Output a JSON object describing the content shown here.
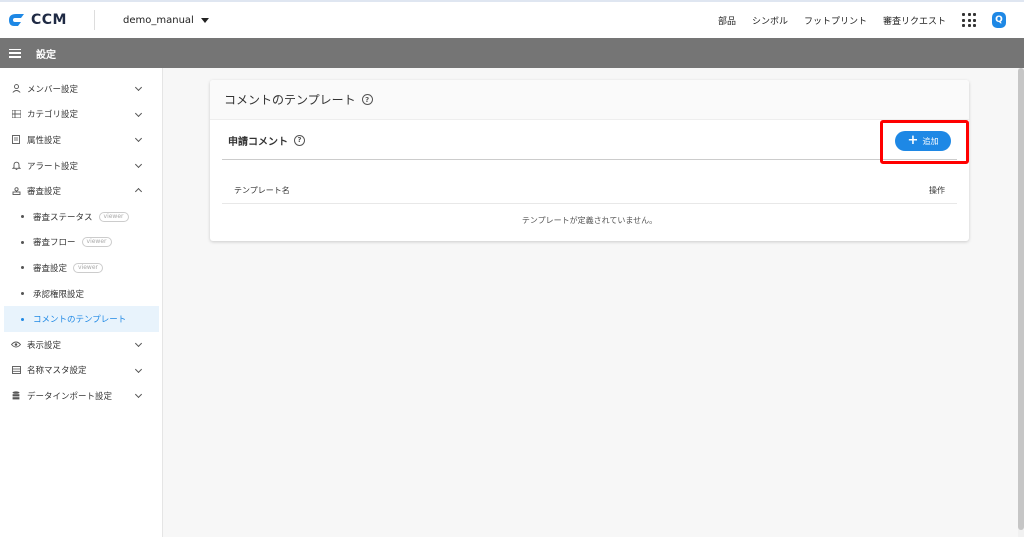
{
  "header": {
    "logo_text": "CCM",
    "project_name": "demo_manual",
    "nav": [
      "部品",
      "シンボル",
      "フットプリント",
      "審査リクエスト"
    ],
    "user_initial": "Q",
    "colors": {
      "brand": "#1e88e5",
      "section_bar": "#757575"
    }
  },
  "section": {
    "title": "設定"
  },
  "sidebar": {
    "items": [
      {
        "label": "メンバー設定",
        "icon": "person-icon",
        "expanded": false
      },
      {
        "label": "カテゴリ設定",
        "icon": "list-icon",
        "expanded": false
      },
      {
        "label": "属性設定",
        "icon": "document-icon",
        "expanded": false
      },
      {
        "label": "アラート設定",
        "icon": "bell-icon",
        "expanded": false
      },
      {
        "label": "審査設定",
        "icon": "stamp-icon",
        "expanded": true
      }
    ],
    "review_sub": [
      {
        "label": "審査ステータス",
        "badge": "viewer"
      },
      {
        "label": "審査フロー",
        "badge": "viewer"
      },
      {
        "label": "審査設定",
        "badge": "viewer"
      },
      {
        "label": "承認権限設定",
        "badge": ""
      },
      {
        "label": "コメントのテンプレート",
        "badge": "",
        "active": true
      }
    ],
    "items_after": [
      {
        "label": "表示設定",
        "icon": "eye-icon",
        "expanded": false
      },
      {
        "label": "名称マスタ設定",
        "icon": "table-icon",
        "expanded": false
      },
      {
        "label": "データインポート設定",
        "icon": "database-icon",
        "expanded": false
      }
    ]
  },
  "main": {
    "card_title": "コメントのテンプレート",
    "section_title": "申請コメント",
    "add_label": "追加",
    "table": {
      "columns": [
        "テンプレート名",
        "操作"
      ],
      "empty_message": "テンプレートが定義されていません。"
    }
  }
}
